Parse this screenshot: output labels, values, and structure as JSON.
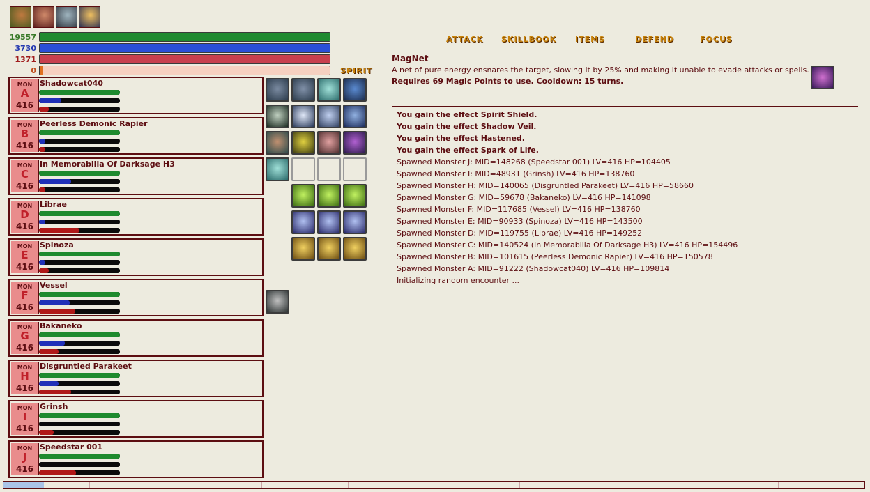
{
  "party": [
    {
      "name": "portrait-1",
      "colors": [
        "#4a5a20",
        "#c07a40"
      ]
    },
    {
      "name": "portrait-2",
      "colors": [
        "#5a1d1d",
        "#d08a6a"
      ]
    },
    {
      "name": "portrait-3",
      "colors": [
        "#303640",
        "#a0b6c0"
      ]
    },
    {
      "name": "portrait-4",
      "colors": [
        "#2a2f52",
        "#f0c060"
      ]
    }
  ],
  "player": {
    "hp": {
      "value": "19557",
      "fraction": 1.0,
      "color": "#1F8A30",
      "text_color": "#3A7A2A"
    },
    "mp": {
      "value": "3730",
      "fraction": 1.0,
      "color": "#2A4FD8",
      "text_color": "#2438B0"
    },
    "sp": {
      "value": "1371",
      "fraction": 1.0,
      "color": "#C8404E",
      "text_color": "#A01C1C"
    },
    "oc": {
      "value": "0",
      "fraction": 0.0,
      "color": "#E07020",
      "text_color": "#C05020"
    }
  },
  "spirit_label": "SPIRIT",
  "menu": {
    "attack": "ATTACK",
    "skillbook": "SKILLBOOK",
    "items": "ITEMS",
    "defend": "DEFEND",
    "focus": "FOCUS"
  },
  "skill_info": {
    "title": "MagNet",
    "description": "A net of pure energy ensnares the target, slowing it by 25% and making it unable to evade attacks or spells.",
    "requirement": "Requires 69 Magic Points to use. Cooldown: 15 turns."
  },
  "monsters": [
    {
      "tag": "MON",
      "letter": "A",
      "level": "416",
      "name": "Shadowcat040",
      "hp": 1.0,
      "mp": 0.28,
      "sp": 0.12
    },
    {
      "tag": "MON",
      "letter": "B",
      "level": "416",
      "name": "Peerless Demonic Rapier",
      "hp": 1.0,
      "mp": 0.08,
      "sp": 0.08
    },
    {
      "tag": "MON",
      "letter": "C",
      "level": "416",
      "name": "In Memorabilia Of Darksage H3",
      "hp": 1.0,
      "mp": 0.4,
      "sp": 0.08
    },
    {
      "tag": "MON",
      "letter": "D",
      "level": "416",
      "name": "Librae",
      "hp": 1.0,
      "mp": 0.08,
      "sp": 0.5
    },
    {
      "tag": "MON",
      "letter": "E",
      "level": "416",
      "name": "Spinoza",
      "hp": 1.0,
      "mp": 0.08,
      "sp": 0.12
    },
    {
      "tag": "MON",
      "letter": "F",
      "level": "416",
      "name": "Vessel",
      "hp": 1.0,
      "mp": 0.38,
      "sp": 0.45
    },
    {
      "tag": "MON",
      "letter": "G",
      "level": "416",
      "name": "Bakaneko",
      "hp": 1.0,
      "mp": 0.32,
      "sp": 0.24
    },
    {
      "tag": "MON",
      "letter": "H",
      "level": "416",
      "name": "Disgruntled Parakeet",
      "hp": 1.0,
      "mp": 0.24,
      "sp": 0.4
    },
    {
      "tag": "MON",
      "letter": "I",
      "level": "416",
      "name": "Grinsh",
      "hp": 1.0,
      "mp": 0.0,
      "sp": 0.18
    },
    {
      "tag": "MON",
      "letter": "J",
      "level": "416",
      "name": "Speedstar 001",
      "hp": 1.0,
      "mp": 0.0,
      "sp": 0.46
    }
  ],
  "effects_icons": [
    {
      "name": "buff-icon-1",
      "c1": "#2a3a4a",
      "c2": "#7a8aa0"
    },
    {
      "name": "buff-icon-2",
      "c1": "#2a3a4a",
      "c2": "#8090a8"
    },
    {
      "name": "buff-icon-3",
      "c1": "#2a6a6a",
      "c2": "#a0e0d8"
    },
    {
      "name": "buff-icon-4",
      "c1": "#1a2a4a",
      "c2": "#5a8ad0"
    },
    {
      "name": "buff-icon-5",
      "c1": "#1a2a20",
      "c2": "#c0d0c0"
    },
    {
      "name": "buff-icon-6",
      "c1": "#2a3a5a",
      "c2": "#e0e8f8"
    },
    {
      "name": "buff-icon-7",
      "c1": "#304060",
      "c2": "#c0d0f0"
    },
    {
      "name": "buff-icon-8",
      "c1": "#1a2a5a",
      "c2": "#90b0e0"
    },
    {
      "name": "buff-icon-9",
      "c1": "#2a4a4a",
      "c2": "#c09070"
    },
    {
      "name": "buff-icon-10",
      "c1": "#3a3a10",
      "c2": "#e0d040"
    },
    {
      "name": "buff-icon-11",
      "c1": "#4a2a2a",
      "c2": "#e0a0a0"
    },
    {
      "name": "buff-icon-12",
      "c1": "#2a1a4a",
      "c2": "#b060d0"
    },
    {
      "name": "buff-icon-13",
      "c1": "#2a6a6a",
      "c2": "#a0e0d8"
    }
  ],
  "quickbar_icons": [
    {
      "name": "green-cross-icon",
      "c1": "#3a6a10",
      "c2": "#c0f060"
    },
    {
      "name": "blue-cross-icon",
      "c1": "#2a2a6a",
      "c2": "#b0c0f0"
    },
    {
      "name": "gold-cross-icon",
      "c1": "#6a4a10",
      "c2": "#f0d060"
    }
  ],
  "special_icon": {
    "name": "claw-icon",
    "c1": "#2a3030",
    "c2": "#c0c0c0"
  },
  "log": [
    {
      "text": "You gain the effect Spirit Shield.",
      "bold": true
    },
    {
      "text": "You gain the effect Shadow Veil.",
      "bold": true
    },
    {
      "text": "You gain the effect Hastened.",
      "bold": true
    },
    {
      "text": "You gain the effect Spark of Life.",
      "bold": true
    },
    {
      "text": "Spawned Monster J: MID=148268 (Speedstar 001) LV=416 HP=104405",
      "bold": false
    },
    {
      "text": "Spawned Monster I: MID=48931 (Grinsh) LV=416 HP=138760",
      "bold": false
    },
    {
      "text": "Spawned Monster H: MID=140065 (Disgruntled Parakeet) LV=416 HP=58660",
      "bold": false
    },
    {
      "text": "Spawned Monster G: MID=59678 (Bakaneko) LV=416 HP=141098",
      "bold": false
    },
    {
      "text": "Spawned Monster F: MID=117685 (Vessel) LV=416 HP=138760",
      "bold": false
    },
    {
      "text": "Spawned Monster E: MID=90933 (Spinoza) LV=416 HP=143500",
      "bold": false
    },
    {
      "text": "Spawned Monster D: MID=119755 (Librae) LV=416 HP=149252",
      "bold": false
    },
    {
      "text": "Spawned Monster C: MID=140524 (In Memorabilia Of Darksage H3) LV=416 HP=154496",
      "bold": false
    },
    {
      "text": "Spawned Monster B: MID=101615 (Peerless Demonic Rapier) LV=416 HP=150578",
      "bold": false
    },
    {
      "text": "Spawned Monster A: MID=91222 (Shadowcat040) LV=416 HP=109814",
      "bold": false
    },
    {
      "text": "Initializing random encounter ...",
      "bold": false
    }
  ],
  "bottom_bar": {
    "fill": 0.047,
    "fill_color": "#A9C4E8",
    "segments": 10
  }
}
